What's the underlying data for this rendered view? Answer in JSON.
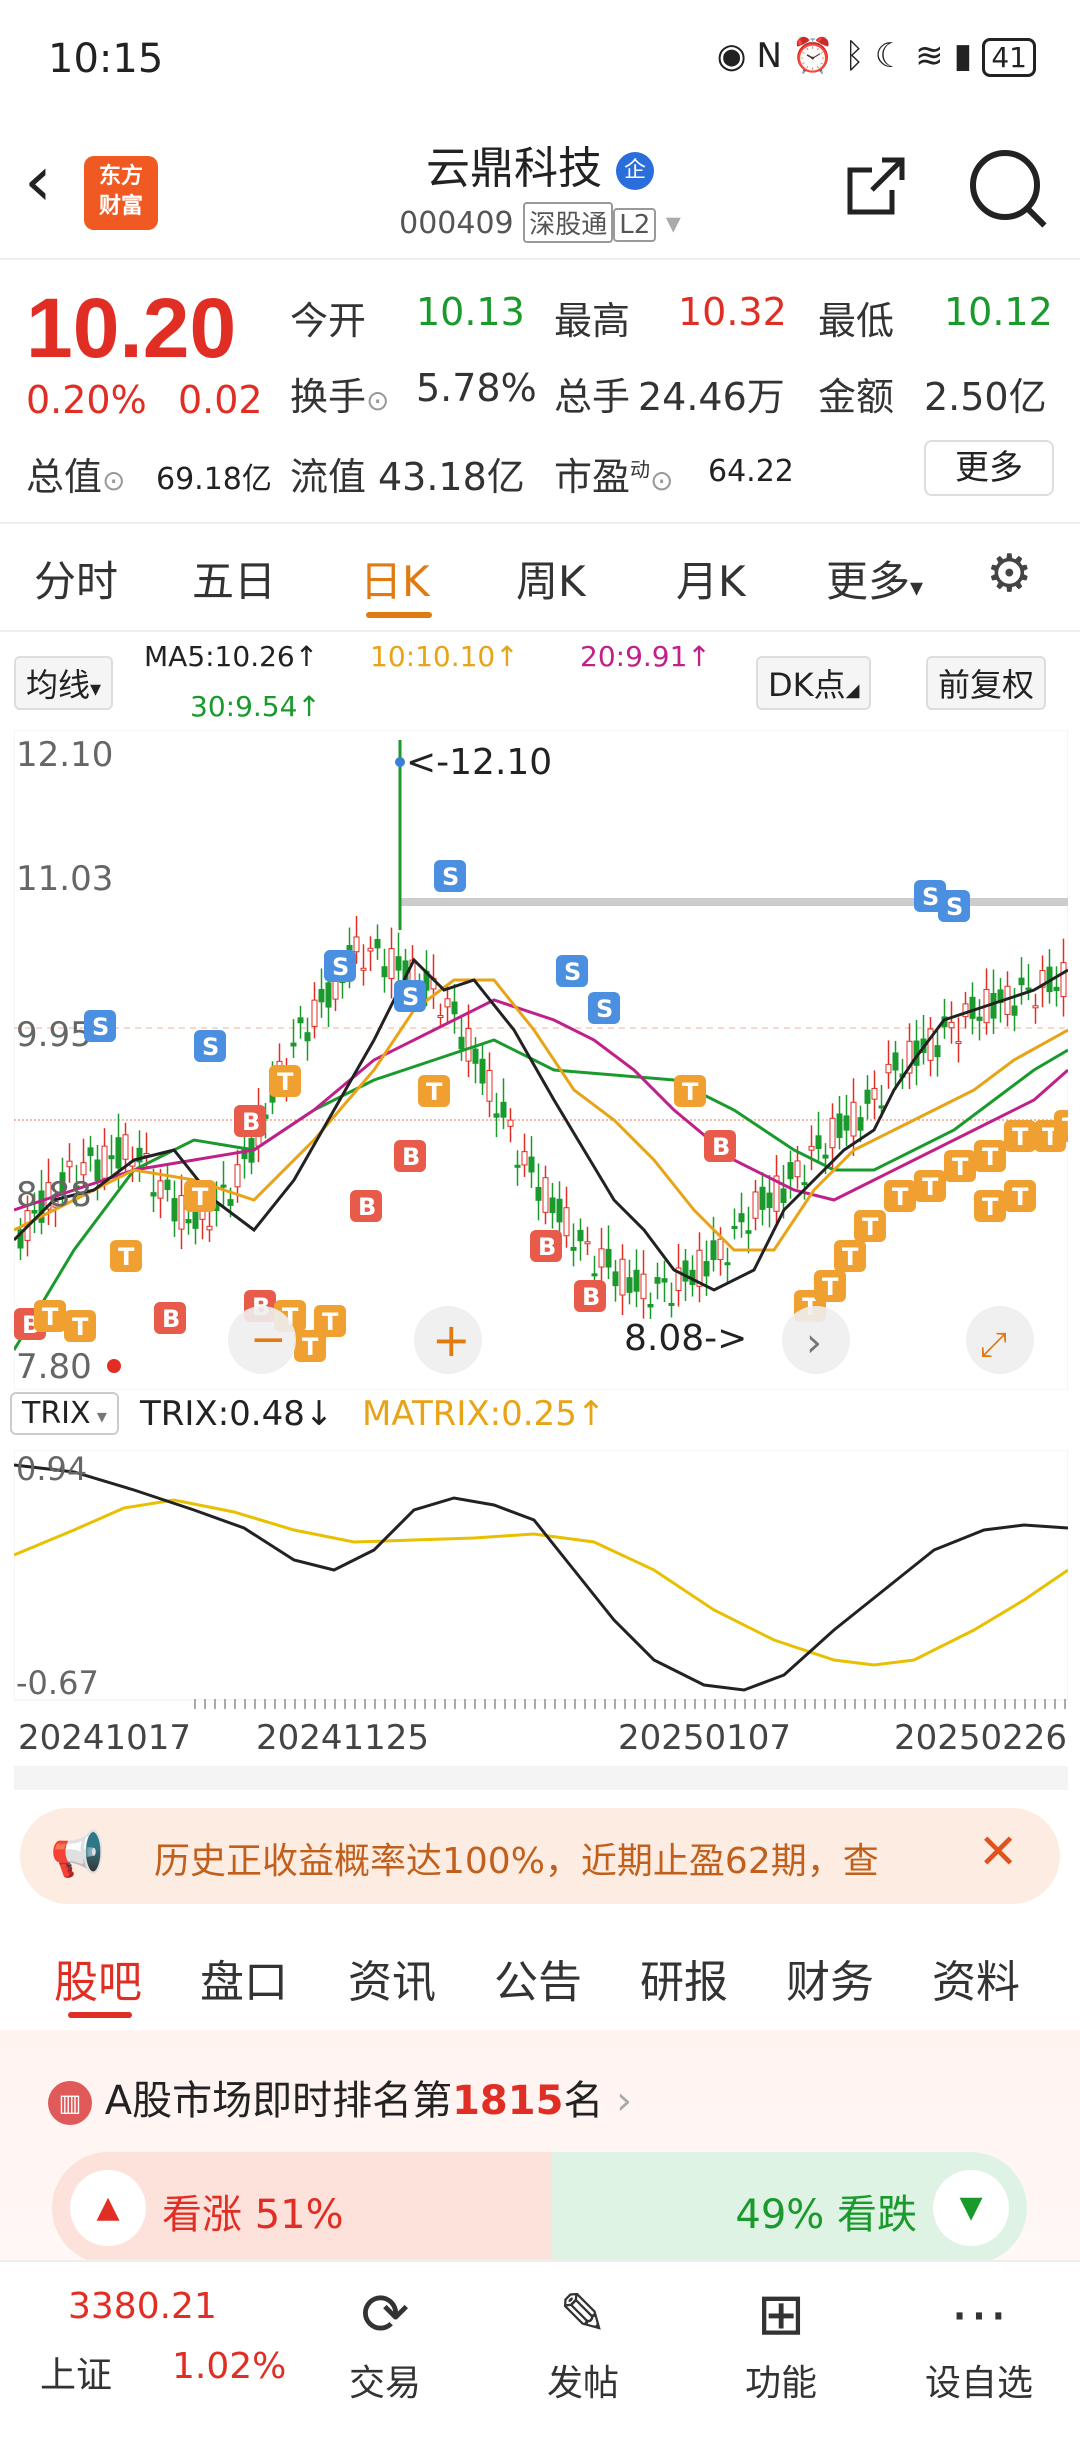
{
  "status": {
    "time": "10:15",
    "battery": "41"
  },
  "header": {
    "logo": "东方\n财富",
    "name": "云鼎科技",
    "badge": "企",
    "code": "000409",
    "tag1": "深股通",
    "tag2": "L2"
  },
  "quote": {
    "price": "10.20",
    "pct": "0.20%",
    "chg": "0.02",
    "open_l": "今开",
    "open": "10.13",
    "high_l": "最高",
    "high": "10.32",
    "low_l": "最低",
    "low": "10.12",
    "turnover_l": "换手",
    "turnover": "5.78%",
    "volume_l": "总手",
    "volume": "24.46万",
    "amount_l": "金额",
    "amount": "2.50亿",
    "mcap_l": "总值",
    "mcap": "69.18亿",
    "float_l": "流值",
    "float": "43.18亿",
    "pe_l": "市盈",
    "pe_sup": "动",
    "pe": "64.22",
    "more": "更多"
  },
  "tabs": [
    "分时",
    "五日",
    "日K",
    "周K",
    "月K",
    "更多"
  ],
  "ma": {
    "sel": "均线",
    "ma5": "MA5:10.26↑",
    "ma10": "10:10.10↑",
    "ma20": "20:9.91↑",
    "ma30": "30:9.54↑",
    "dk": "DK点",
    "fq": "前复权"
  },
  "kchart": {
    "y_labels": [
      "12.10",
      "11.03",
      "9.95",
      "8.88",
      "7.80"
    ],
    "max_note": "<-12.10",
    "min_note": "8.08->"
  },
  "trix": {
    "sel": "TRIX",
    "trix": "TRIX:0.48↓",
    "matrix": "MATRIX:0.25↑",
    "y_top": "0.94",
    "y_bot": "-0.67"
  },
  "dates": [
    "20241017",
    "20241125",
    "20250107",
    "20250226"
  ],
  "notice": "历史正收益概率达100%，近期止盈62期，查",
  "btabs": [
    "股吧",
    "盘口",
    "资讯",
    "公告",
    "研报",
    "财务",
    "资料"
  ],
  "rank": {
    "pre": "A股市场即时排名第",
    "num": "1815",
    "post": "名"
  },
  "vote": {
    "up": "看涨 51%",
    "down": "49% 看跌"
  },
  "bottom": {
    "index_val": "3380.21",
    "index_name": "上证",
    "index_pct": "1.02%",
    "items": [
      "交易",
      "发帖",
      "功能",
      "设自选"
    ]
  },
  "colors": {
    "red": "#e02e24",
    "green": "#1a9a2d",
    "orange": "#e07b14",
    "ma5": "#222222",
    "ma10": "#e8a317",
    "ma20": "#c0208a",
    "ma30": "#1a9a2d"
  }
}
